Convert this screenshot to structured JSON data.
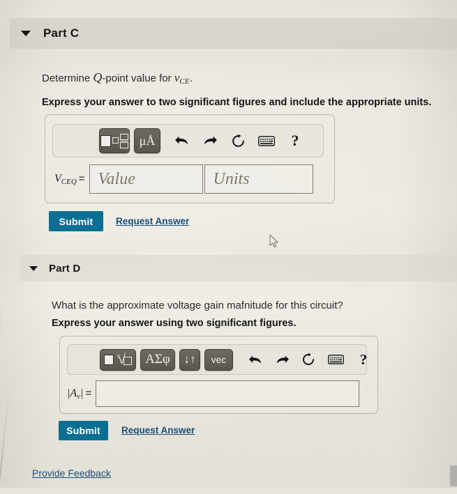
{
  "page": {
    "background_color": "#e9e6dd",
    "accent_button_color": "#0b6f93",
    "link_color": "#1a4f77"
  },
  "part_c": {
    "header": {
      "title": "Part C",
      "chevron": "chevron-down-icon",
      "expanded": true
    },
    "question": {
      "prefix": "Determine ",
      "symbol_q": "Q",
      "middle": "-point value for ",
      "symbol_v": "v",
      "symbol_v_sub": "CE",
      "suffix": "."
    },
    "instruction": "Express your answer to two significant figures and include the appropriate units.",
    "toolbar": {
      "buttons": [
        {
          "name": "math-template-button",
          "label": ""
        },
        {
          "name": "units-button",
          "label": "μÅ"
        }
      ],
      "icons": [
        {
          "name": "undo-icon",
          "label": "undo"
        },
        {
          "name": "redo-icon",
          "label": "redo"
        },
        {
          "name": "reset-icon",
          "label": "reset"
        },
        {
          "name": "keyboard-icon",
          "label": "keyboard shortcuts"
        },
        {
          "name": "help-icon",
          "label": "?"
        }
      ]
    },
    "answer": {
      "lhs_symbol": "V",
      "lhs_subscript": "CEQ",
      "equals": "=",
      "value_placeholder": "Value",
      "value": "",
      "units_placeholder": "Units",
      "units": ""
    },
    "submit_label": "Submit",
    "request_answer_label": "Request Answer"
  },
  "part_d": {
    "header": {
      "title": "Part D",
      "chevron": "chevron-down-icon",
      "expanded": true
    },
    "question": "What is the approximate voltage gain mafnitude for this circuit?",
    "instruction": "Express your answer using two significant figures.",
    "toolbar": {
      "buttons": [
        {
          "name": "math-template-button",
          "label": ""
        },
        {
          "name": "greek-symbols-button",
          "label": "ΑΣφ"
        },
        {
          "name": "arrows-button",
          "label": "↓↑"
        },
        {
          "name": "vector-button",
          "label": "vec"
        }
      ],
      "icons": [
        {
          "name": "undo-icon",
          "label": "undo"
        },
        {
          "name": "redo-icon",
          "label": "redo"
        },
        {
          "name": "reset-icon",
          "label": "reset"
        },
        {
          "name": "keyboard-icon",
          "label": "keyboard shortcuts"
        },
        {
          "name": "help-icon",
          "label": "?"
        }
      ]
    },
    "answer": {
      "lhs_open": "|",
      "lhs_symbol": "A",
      "lhs_subscript": "v",
      "lhs_close": "|",
      "equals": "=",
      "value": "",
      "placeholder": ""
    },
    "submit_label": "Submit",
    "request_answer_label": "Request Answer"
  },
  "footer": {
    "provide_feedback_label": "Provide Feedback"
  }
}
